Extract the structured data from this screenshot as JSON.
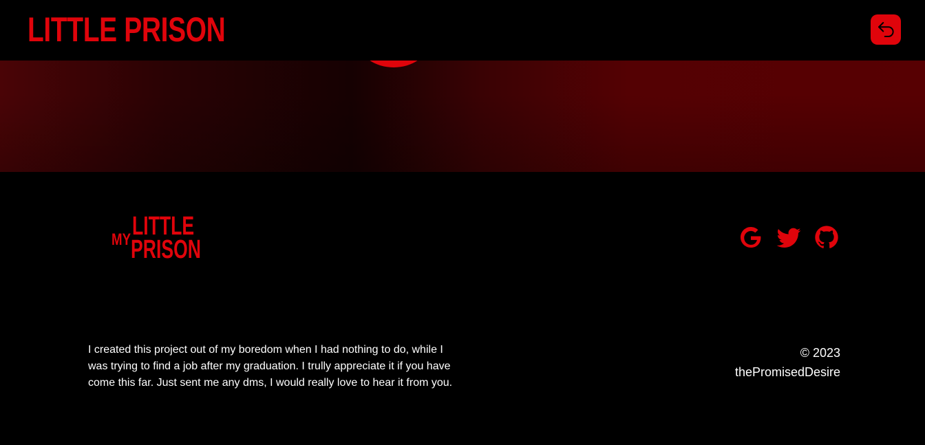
{
  "header": {
    "title": "LITTLE PRISON",
    "back_button_icon": "undo-arrow-icon"
  },
  "footer": {
    "logo": {
      "my": "MY",
      "little": "LITTLE",
      "prison": "PRISON"
    },
    "social": [
      {
        "name": "google",
        "icon": "google-icon"
      },
      {
        "name": "twitter",
        "icon": "twitter-icon"
      },
      {
        "name": "github",
        "icon": "github-icon"
      }
    ],
    "about": "I created this project out of my boredom when I had nothing to do, while I was trying to find a job after my graduation. I trully appreciate it if you have come this far. Just sent me any dms, I would really love to hear it from you.",
    "copyright": {
      "year": "© 2023",
      "author": "thePromisedDesire"
    }
  },
  "colors": {
    "accent": "#e0040b",
    "background": "#000000",
    "banner_dark": "#160102",
    "banner_red": "#570002",
    "text": "#ffffff"
  }
}
